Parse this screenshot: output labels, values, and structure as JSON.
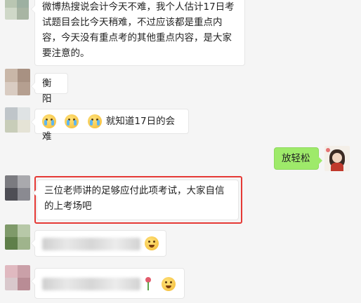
{
  "messages": [
    {
      "id": "m1",
      "side": "left",
      "text": "微博热搜说会计今天不难，我个人估计17日考试题目会比今天稍难，不过应该都是重点内容，今天没有重点考的其他重点内容，是大家要注意的。"
    },
    {
      "id": "m2",
      "side": "left",
      "text": "衡阳"
    },
    {
      "id": "m3",
      "side": "left",
      "text": "就知道17日的会难",
      "emojis": [
        "crying-emoji",
        "crying-emoji",
        "crying-emoji"
      ]
    },
    {
      "id": "m4",
      "side": "right",
      "text": "放轻松"
    },
    {
      "id": "m5",
      "side": "left",
      "text": "三位老师讲的足够应付此项考试，大家自信的上考场吧",
      "highlighted": true
    },
    {
      "id": "m6",
      "side": "left",
      "text": "",
      "redacted": true,
      "emojis": [
        "thinking-emoji"
      ]
    },
    {
      "id": "m7",
      "side": "left",
      "text": "",
      "redacted": true,
      "emojis": [
        "rose-emoji",
        "thinking-emoji"
      ]
    }
  ],
  "colors": {
    "highlight": "#e53935",
    "self_bubble": "#9eea6a",
    "background": "#f5f5f5"
  }
}
